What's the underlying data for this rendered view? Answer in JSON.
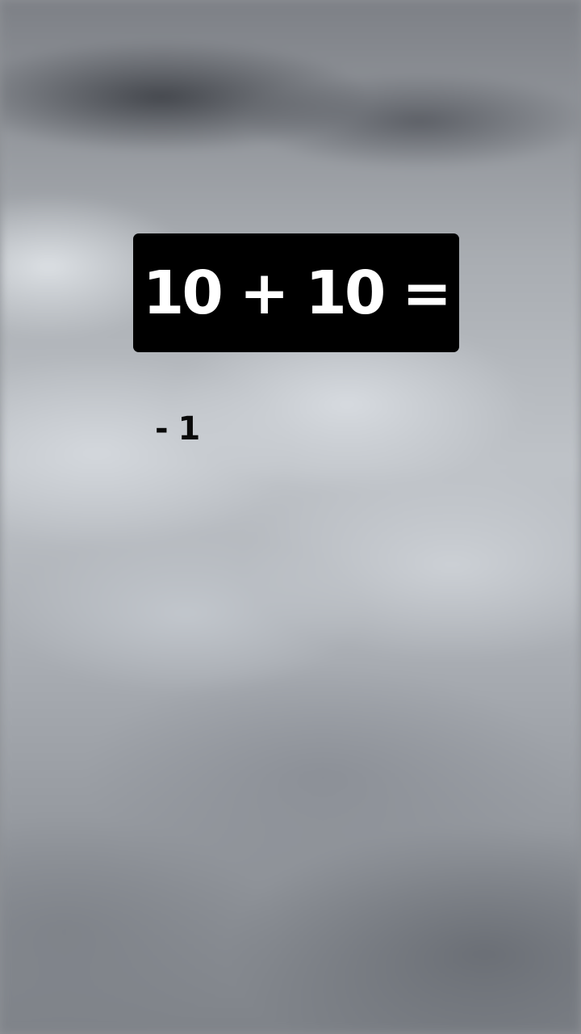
{
  "question": {
    "text": "10 + 10 ="
  },
  "answers": [
    {
      "text": "- 1"
    }
  ],
  "colors": {
    "question_background": "#000000",
    "question_text": "#ffffff",
    "answer_text": "#0a0a0a"
  }
}
